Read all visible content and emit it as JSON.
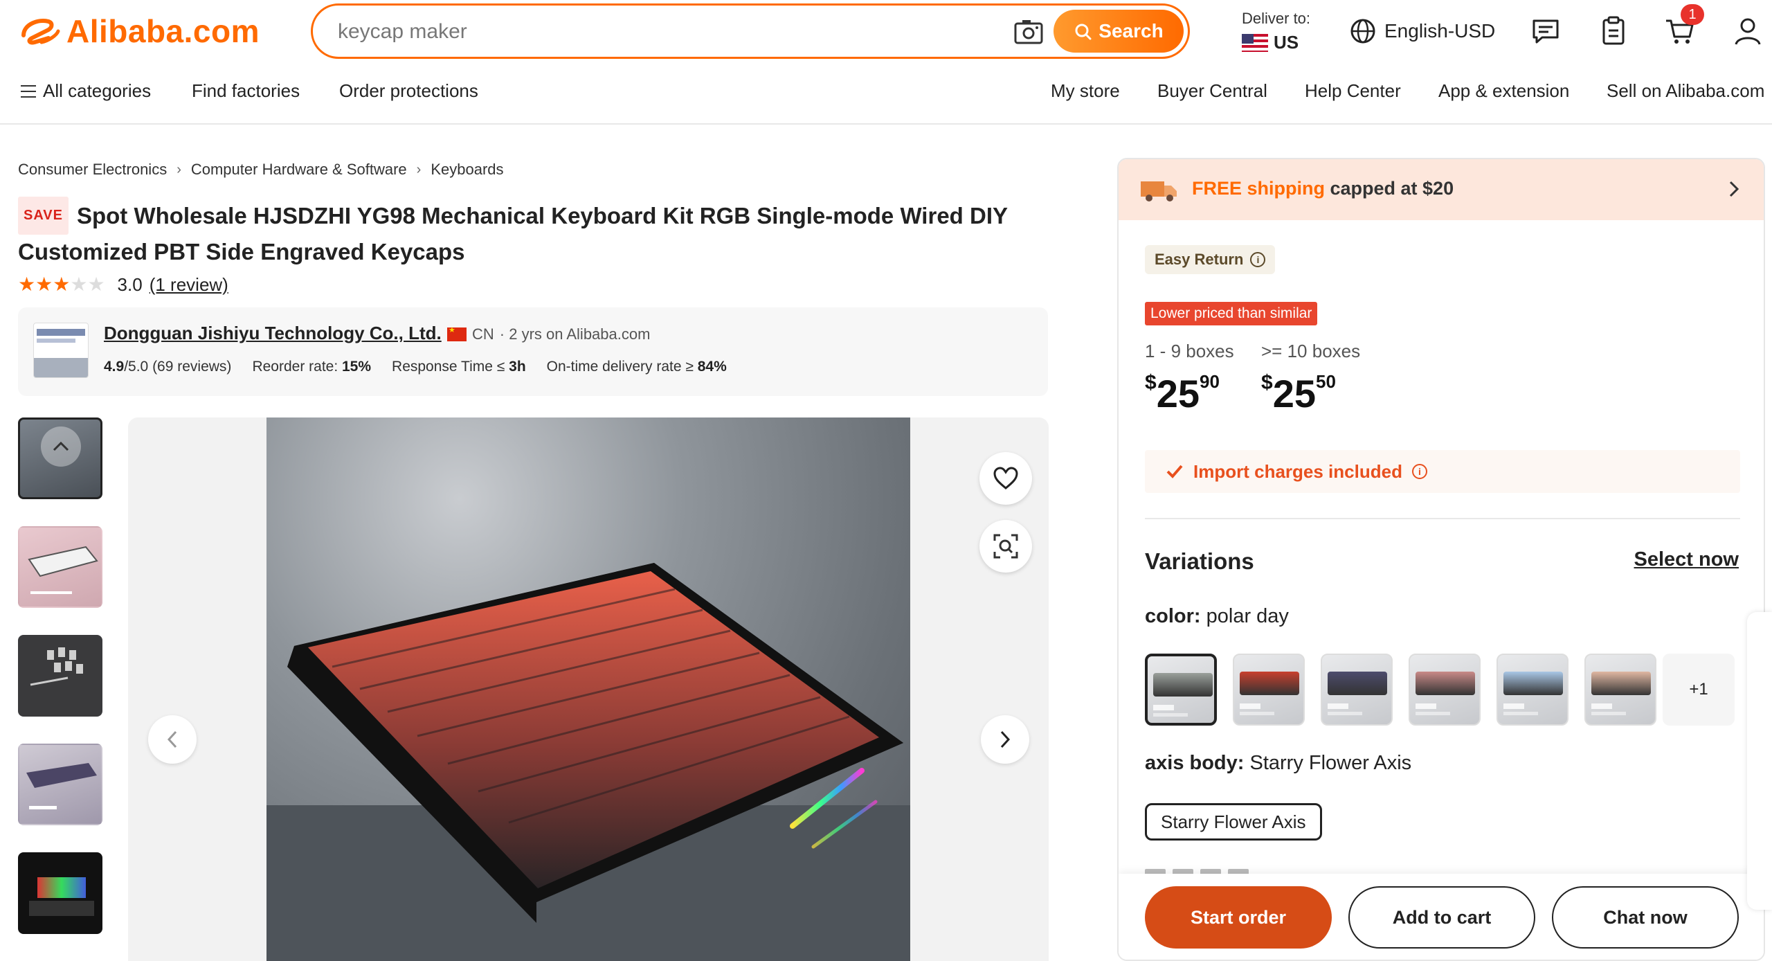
{
  "brand": {
    "name": "Alibaba.com",
    "color": "#ff6a00"
  },
  "search": {
    "placeholder": "keycap maker",
    "button_label": "Search"
  },
  "header": {
    "deliver_label": "Deliver to:",
    "deliver_country": "US",
    "language": "English-USD",
    "cart_count": "1",
    "icons": [
      "messages-icon",
      "orders-icon",
      "cart-icon",
      "account-icon"
    ]
  },
  "nav": {
    "left": [
      "All categories",
      "Find factories",
      "Order protections"
    ],
    "right": [
      "My store",
      "Buyer Central",
      "Help Center",
      "App & extension",
      "Sell on Alibaba.com"
    ]
  },
  "breadcrumb": [
    "Consumer Electronics",
    "Computer Hardware & Software",
    "Keyboards"
  ],
  "product": {
    "badge": "SAVE",
    "title": "Spot Wholesale HJSDZHI YG98 Mechanical Keyboard Kit RGB Single-mode Wired DIY Customized PBT Side Engraved Keycaps",
    "rating": 3.0,
    "rating_text": "3.0",
    "stars_filled": 3,
    "stars_total": 5,
    "reviews": "(1 review)"
  },
  "supplier": {
    "name": "Dongguan Jishiyu Technology Co., Ltd.",
    "country": "CN",
    "years": "· 2 yrs on Alibaba.com",
    "score": "4.9",
    "score_suffix": "/5.0 (69 reviews)",
    "reorder_label": "Reorder rate: ",
    "reorder_value": "15%",
    "response_label": "Response Time ≤ ",
    "response_value": "3h",
    "ontime_label": "On-time delivery rate ≥ ",
    "ontime_value": "84%"
  },
  "gallery": {
    "thumbnails": 5,
    "selected": 0
  },
  "panel": {
    "shipping_free": "FREE shipping",
    "shipping_rest": " capped at $20",
    "easy_return": "Easy Return",
    "lower_price_badge": "Lower priced than similar",
    "tiers": [
      {
        "qty": "1 - 9 boxes",
        "currency": "$",
        "whole": "25",
        "cents": "90"
      },
      {
        "qty": ">= 10 boxes",
        "currency": "$",
        "whole": "25",
        "cents": "50"
      }
    ],
    "import_charges": "Import charges included",
    "variations_title": "Variations",
    "select_now": "Select now",
    "color_label": "color:",
    "color_value": "polar day",
    "color_swatches": [
      "#9aa09b",
      "#c8402e",
      "#4d4c6d",
      "#c98a88",
      "#a9c7e6",
      "#e0b7a2"
    ],
    "color_more": "+1",
    "axis_label": "axis body:",
    "axis_value": "Starry Flower Axis",
    "axis_option": "Starry Flower Axis",
    "start_order": "Start order",
    "add_to_cart": "Add to cart",
    "chat_now": "Chat now"
  }
}
